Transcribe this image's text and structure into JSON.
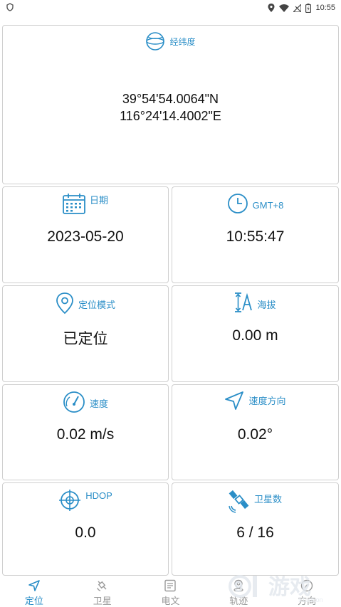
{
  "status_bar": {
    "time": "10:55",
    "icons": [
      "shield-icon",
      "location-icon",
      "wifi-icon",
      "no-signal-icon",
      "battery-icon"
    ]
  },
  "colors": {
    "accent": "#2a8ec7",
    "inactive": "#9a9a9a",
    "border": "#cfcfcf"
  },
  "latlon": {
    "label": "经纬度",
    "lat": "39°54'54.0064\"N",
    "lon": "116°24'14.4002\"E"
  },
  "cards": {
    "date": {
      "label": "日期",
      "value": "2023-05-20",
      "icon": "calendar-icon"
    },
    "timezone": {
      "label": "GMT+8",
      "value": "10:55:47",
      "icon": "clock-icon"
    },
    "mode": {
      "label": "定位模式",
      "value": "已定位",
      "icon": "location-pin-icon"
    },
    "altitude": {
      "label": "海拔",
      "value": "0.00 m",
      "icon": "altitude-icon"
    },
    "speed": {
      "label": "速度",
      "value": "0.02 m/s",
      "icon": "speedometer-icon"
    },
    "heading": {
      "label": "速度方向",
      "value": "0.02°",
      "icon": "navigation-arrow-icon"
    },
    "hdop": {
      "label": "HDOP",
      "value": "0.0",
      "icon": "crosshair-icon"
    },
    "satellites": {
      "label": "卫星数",
      "value": "6 / 16",
      "icon": "satellite-icon"
    }
  },
  "nav": [
    {
      "label": "定位",
      "icon": "navigation-arrow-icon",
      "active": true
    },
    {
      "label": "卫星",
      "icon": "satellite-icon",
      "active": false
    },
    {
      "label": "电文",
      "icon": "document-icon",
      "active": false
    },
    {
      "label": "轨迹",
      "icon": "track-pin-icon",
      "active": false
    },
    {
      "label": "方向",
      "icon": "compass-icon",
      "active": false
    }
  ],
  "watermark": {
    "brand_text": "游戏",
    "brand_number": "9",
    "site": "91udcon"
  }
}
